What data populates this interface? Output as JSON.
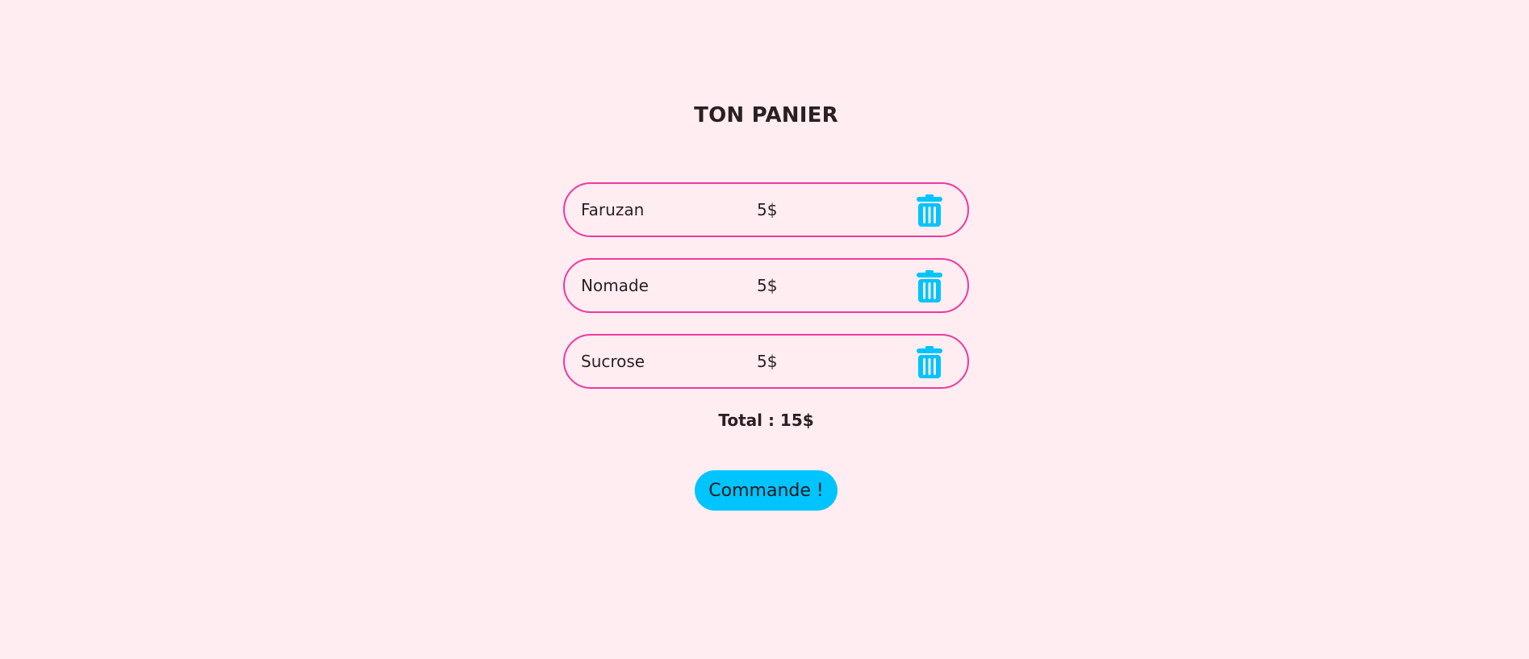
{
  "cart": {
    "title": "TON PANIER",
    "items": [
      {
        "name": "Faruzan",
        "price": "5$"
      },
      {
        "name": "Nomade",
        "price": "5$"
      },
      {
        "name": "Sucrose",
        "price": "5$"
      }
    ],
    "total": "Total : 15$",
    "order_label": "Commande !"
  },
  "icons": {
    "delete": "trash-icon"
  },
  "colors": {
    "background": "#ffedf2",
    "item_border": "#f0399f",
    "accent": "#00c4ff",
    "text": "#2b1f22"
  }
}
